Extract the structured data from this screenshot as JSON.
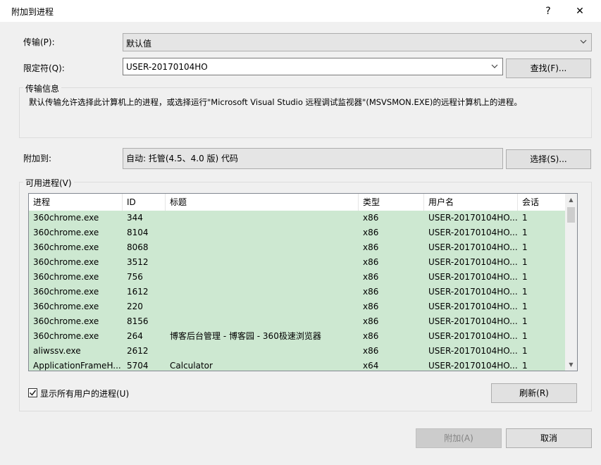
{
  "window": {
    "title": "附加到进程",
    "help": "?",
    "close": "✕"
  },
  "transport": {
    "label": "传输(P):",
    "value": "默认值"
  },
  "qualifier": {
    "label": "限定符(Q):",
    "value": "USER-20170104HO",
    "find_button": "查找(F)..."
  },
  "transport_info": {
    "title": "传输信息",
    "text": "默认传输允许选择此计算机上的进程，或选择运行\"Microsoft Visual Studio 远程调试监视器\"(MSVSMON.EXE)的远程计算机上的进程。"
  },
  "attach_to": {
    "label": "附加到:",
    "value": "自动: 托管(4.5、4.0 版) 代码",
    "select_button": "选择(S)..."
  },
  "processes": {
    "title": "可用进程(V)",
    "columns": [
      "进程",
      "ID",
      "标题",
      "类型",
      "用户名",
      "会话"
    ],
    "rows": [
      [
        "360chrome.exe",
        "344",
        "",
        "x86",
        "USER-20170104HO...",
        "1"
      ],
      [
        "360chrome.exe",
        "8104",
        "",
        "x86",
        "USER-20170104HO...",
        "1"
      ],
      [
        "360chrome.exe",
        "8068",
        "",
        "x86",
        "USER-20170104HO...",
        "1"
      ],
      [
        "360chrome.exe",
        "3512",
        "",
        "x86",
        "USER-20170104HO...",
        "1"
      ],
      [
        "360chrome.exe",
        "756",
        "",
        "x86",
        "USER-20170104HO...",
        "1"
      ],
      [
        "360chrome.exe",
        "1612",
        "",
        "x86",
        "USER-20170104HO...",
        "1"
      ],
      [
        "360chrome.exe",
        "220",
        "",
        "x86",
        "USER-20170104HO...",
        "1"
      ],
      [
        "360chrome.exe",
        "8156",
        "",
        "x86",
        "USER-20170104HO...",
        "1"
      ],
      [
        "360chrome.exe",
        "264",
        "博客后台管理 - 博客园 - 360极速浏览器",
        "x86",
        "USER-20170104HO...",
        "1"
      ],
      [
        "aliwssv.exe",
        "2612",
        "",
        "x86",
        "USER-20170104HO...",
        "1"
      ],
      [
        "ApplicationFrameH...",
        "5704",
        "Calculator",
        "x64",
        "USER-20170104HO...",
        "1"
      ]
    ],
    "show_all_label": "显示所有用户的进程(U)",
    "show_all_checked": true,
    "refresh_button": "刷新(R)"
  },
  "footer": {
    "attach_button": "附加(A)",
    "cancel_button": "取消"
  },
  "colors": {
    "row_highlight": "#cde8d1",
    "dialog_bg": "#f0f0f0"
  }
}
